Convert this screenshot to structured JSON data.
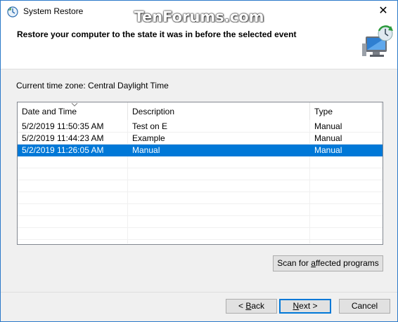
{
  "window": {
    "title": "System Restore",
    "watermark": "TenForums.com",
    "close_glyph": "✕"
  },
  "header": {
    "title": "Restore your computer to the state it was in before the selected event",
    "icon": "system-restore-monitor-icon"
  },
  "timezone_text": "Current time zone: Central Daylight Time",
  "table": {
    "columns": [
      "Date and Time",
      "Description",
      "Type"
    ],
    "rows": [
      {
        "date": "5/2/2019 11:50:35 AM",
        "description": "Test on E",
        "type": "Manual",
        "selected": false
      },
      {
        "date": "5/2/2019 11:44:23 AM",
        "description": "Example",
        "type": "Manual",
        "selected": false
      },
      {
        "date": "5/2/2019 11:26:05 AM",
        "description": "Manual",
        "type": "Manual",
        "selected": true
      }
    ]
  },
  "buttons": {
    "scan_pre": "Scan for ",
    "scan_key": "a",
    "scan_post": "ffected programs",
    "back_pre": "< ",
    "back_key": "B",
    "back_post": "ack",
    "next_key": "N",
    "next_post": "ext >",
    "cancel": "Cancel"
  },
  "colors": {
    "selection": "#0078d7",
    "border": "#2b79c9"
  }
}
